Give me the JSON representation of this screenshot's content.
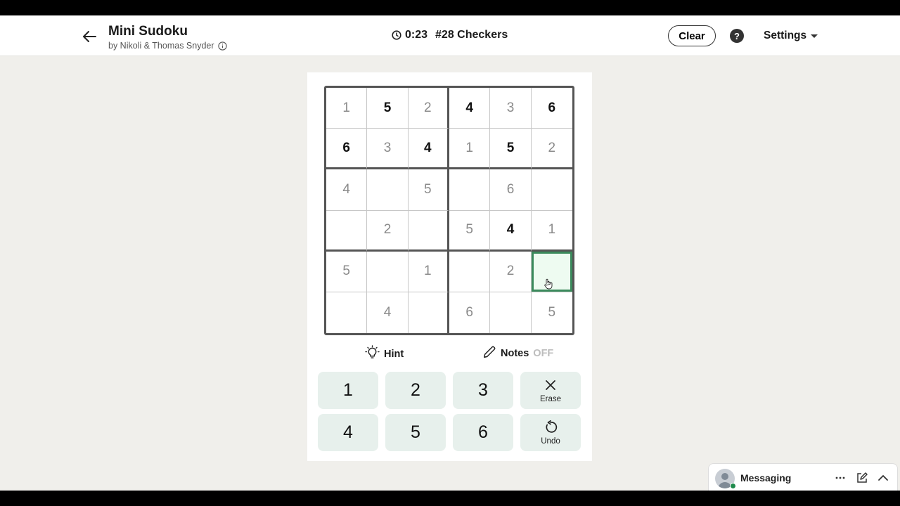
{
  "header": {
    "title": "Mini Sudoku",
    "byline": "by Nikoli & Thomas Snyder",
    "timer": "0:23",
    "puzzle_id": "#28 Checkers",
    "clear_label": "Clear",
    "help_label": "?",
    "settings_label": "Settings"
  },
  "board": {
    "cells": [
      [
        {
          "v": "1",
          "t": "filled"
        },
        {
          "v": "5",
          "t": "given"
        },
        {
          "v": "2",
          "t": "filled"
        },
        {
          "v": "4",
          "t": "given"
        },
        {
          "v": "3",
          "t": "filled"
        },
        {
          "v": "6",
          "t": "given"
        }
      ],
      [
        {
          "v": "6",
          "t": "given"
        },
        {
          "v": "3",
          "t": "filled"
        },
        {
          "v": "4",
          "t": "given"
        },
        {
          "v": "1",
          "t": "filled"
        },
        {
          "v": "5",
          "t": "given"
        },
        {
          "v": "2",
          "t": "filled"
        }
      ],
      [
        {
          "v": "4",
          "t": "filled"
        },
        {
          "v": "",
          "t": "empty"
        },
        {
          "v": "5",
          "t": "filled"
        },
        {
          "v": "",
          "t": "empty"
        },
        {
          "v": "6",
          "t": "filled"
        },
        {
          "v": "",
          "t": "empty"
        }
      ],
      [
        {
          "v": "",
          "t": "empty"
        },
        {
          "v": "2",
          "t": "filled"
        },
        {
          "v": "",
          "t": "empty"
        },
        {
          "v": "5",
          "t": "filled"
        },
        {
          "v": "4",
          "t": "given"
        },
        {
          "v": "1",
          "t": "filled"
        }
      ],
      [
        {
          "v": "5",
          "t": "filled"
        },
        {
          "v": "",
          "t": "empty"
        },
        {
          "v": "1",
          "t": "filled"
        },
        {
          "v": "",
          "t": "empty"
        },
        {
          "v": "2",
          "t": "filled"
        },
        {
          "v": "",
          "t": "selected"
        }
      ],
      [
        {
          "v": "",
          "t": "empty"
        },
        {
          "v": "4",
          "t": "filled"
        },
        {
          "v": "",
          "t": "empty"
        },
        {
          "v": "6",
          "t": "filled"
        },
        {
          "v": "",
          "t": "empty"
        },
        {
          "v": "5",
          "t": "filled"
        }
      ]
    ]
  },
  "toolbar": {
    "hint_label": "Hint",
    "notes_label": "Notes",
    "notes_state": "OFF"
  },
  "keypad": {
    "keys": [
      "1",
      "2",
      "3",
      "4",
      "5",
      "6"
    ],
    "erase_label": "Erase",
    "undo_label": "Undo"
  },
  "messaging": {
    "label": "Messaging"
  },
  "colors": {
    "accent_selected": "#3b8a5c",
    "keypad_bg": "#e7f0ec",
    "page_bg": "#f0efeb"
  }
}
